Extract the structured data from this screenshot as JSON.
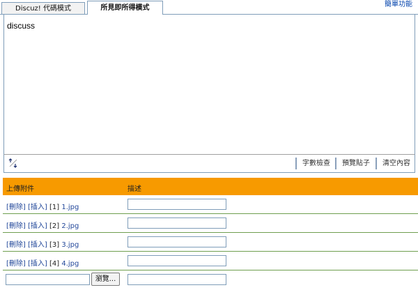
{
  "tabs": [
    {
      "label": "Discuz! 代碼模式"
    },
    {
      "label": "所見即所得模式"
    }
  ],
  "simple_mode_link": "簡單功能",
  "editor": {
    "content": "discuss"
  },
  "toolbar": {
    "resize_icon": "resize-icon",
    "buttons": [
      {
        "label": "字數檢查"
      },
      {
        "label": "預覽貼子"
      },
      {
        "label": "清空內容"
      }
    ]
  },
  "attachments": {
    "header": {
      "col1": "上傳附件",
      "col2": "描述"
    },
    "rows": [
      {
        "delete": "[刪除]",
        "insert": "[插入]",
        "index": "[1]",
        "file": "1.jpg",
        "desc": ""
      },
      {
        "delete": "[刪除]",
        "insert": "[插入]",
        "index": "[2]",
        "file": "2.jpg",
        "desc": ""
      },
      {
        "delete": "[刪除]",
        "insert": "[插入]",
        "index": "[3]",
        "file": "3.jpg",
        "desc": ""
      },
      {
        "delete": "[刪除]",
        "insert": "[插入]",
        "index": "[4]",
        "file": "4.jpg",
        "desc": ""
      }
    ],
    "upload": {
      "file_value": "",
      "browse_label": "瀏覽...",
      "desc": ""
    }
  },
  "colors": {
    "header_bg": "#f79a00",
    "row_border": "#6f9e4f",
    "link": "#23489a"
  }
}
